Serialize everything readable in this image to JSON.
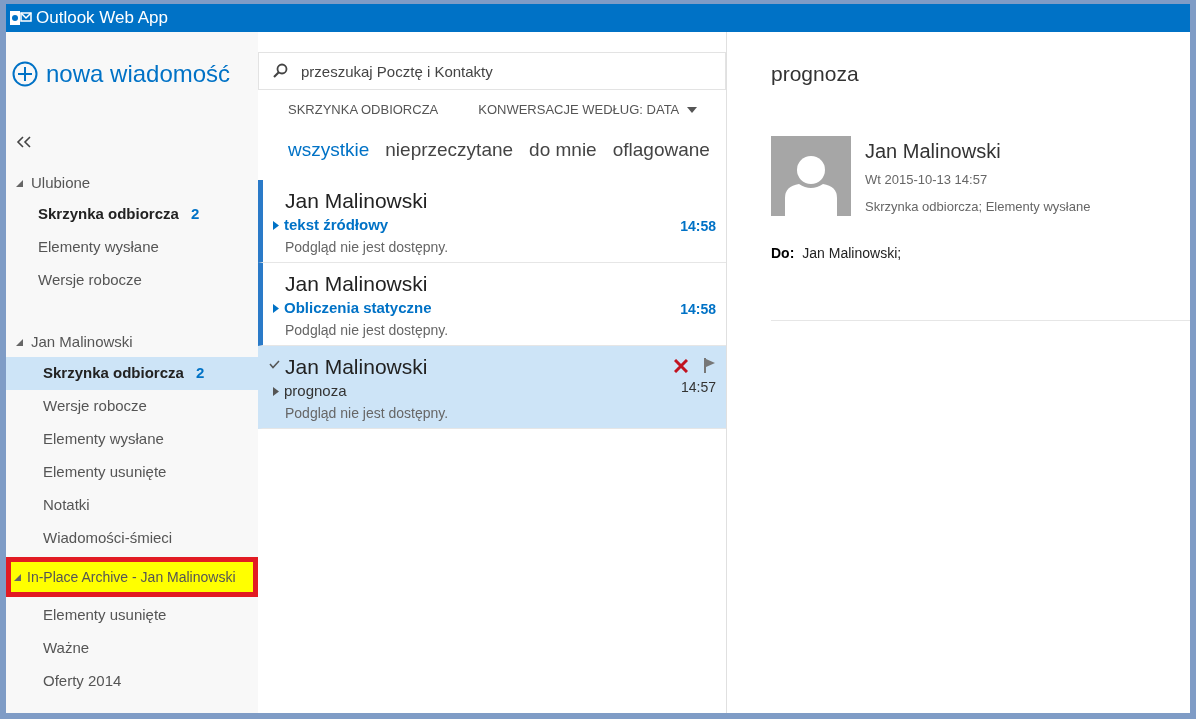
{
  "window": {
    "title": "Outlook Web App"
  },
  "new_message": {
    "label": "nowa wiadomość"
  },
  "search": {
    "placeholder": "przeszukaj Pocztę i Kontakty"
  },
  "list_header": {
    "folder": "SKRZYNKA ODBIORCZA",
    "sort": "KONWERSACJE WEDŁUG: DATA"
  },
  "filters": [
    {
      "label": "wszystkie",
      "selected": true
    },
    {
      "label": "nieprzeczytane",
      "selected": false
    },
    {
      "label": "do mnie",
      "selected": false
    },
    {
      "label": "oflagowane",
      "selected": false
    }
  ],
  "sidebar": {
    "groups": [
      {
        "label": "Ulubione",
        "expanded": true,
        "highlighted": false,
        "children": [
          {
            "label": "Skrzynka odbiorcza",
            "count": "2",
            "unread": true,
            "selected": false
          },
          {
            "label": "Elementy wysłane",
            "unread": false,
            "selected": false
          },
          {
            "label": "Wersje robocze",
            "unread": false,
            "selected": false
          }
        ]
      },
      {
        "label": "Jan Malinowski",
        "expanded": true,
        "highlighted": false,
        "children": [
          {
            "label": "Skrzynka odbiorcza",
            "count": "2",
            "unread": true,
            "selected": true
          },
          {
            "label": "Wersje robocze",
            "unread": false,
            "selected": false
          },
          {
            "label": "Elementy wysłane",
            "unread": false,
            "selected": false
          },
          {
            "label": "Elementy usunięte",
            "unread": false,
            "selected": false
          },
          {
            "label": "Notatki",
            "unread": false,
            "selected": false
          },
          {
            "label": "Wiadomości-śmieci",
            "unread": false,
            "selected": false
          }
        ]
      },
      {
        "label": "In-Place Archive - Jan Malinowski",
        "expanded": true,
        "highlighted": true,
        "children": [
          {
            "label": "Elementy usunięte",
            "unread": false,
            "selected": false
          },
          {
            "label": "Ważne",
            "unread": false,
            "selected": false
          },
          {
            "label": "Oferty 2014",
            "unread": false,
            "selected": false
          }
        ]
      }
    ]
  },
  "messages": [
    {
      "sender": "Jan Malinowski",
      "subject": "tekst źródłowy",
      "preview": "Podgląd nie jest dostępny.",
      "time": "14:58",
      "unread": true,
      "selected": false
    },
    {
      "sender": "Jan Malinowski",
      "subject": "Obliczenia statyczne",
      "preview": "Podgląd nie jest dostępny.",
      "time": "14:58",
      "unread": true,
      "selected": false
    },
    {
      "sender": "Jan Malinowski",
      "subject": "prognoza",
      "preview": "Podgląd nie jest dostępny.",
      "time": "14:57",
      "unread": false,
      "selected": true
    }
  ],
  "reading_pane": {
    "subject": "prognoza",
    "sender": "Jan Malinowski",
    "date": "Wt 2015-10-13 14:57",
    "folders": "Skrzynka odbiorcza; Elementy wysłane",
    "to_label": "Do:",
    "to": "Jan Malinowski;"
  }
}
